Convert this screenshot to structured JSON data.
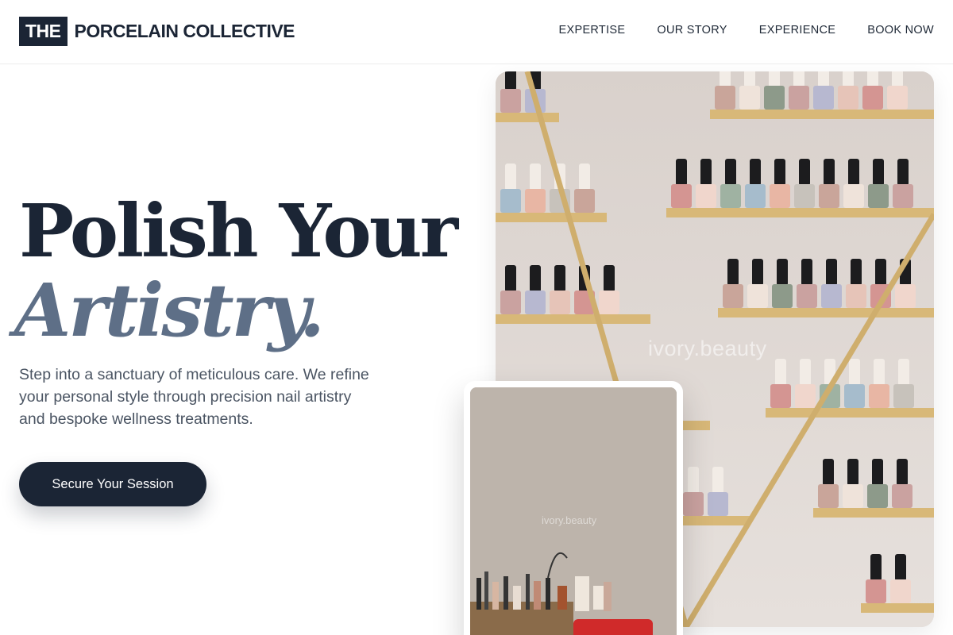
{
  "brand": {
    "box": "THE",
    "name": "PORCELAIN COLLECTIVE"
  },
  "nav": [
    "EXPERTISE",
    "OUR STORY",
    "EXPERIENCE",
    "BOOK NOW"
  ],
  "hero": {
    "line1": "Polish Your",
    "line2": "Artistry.",
    "intro": "Step into a sanctuary of meticulous care. We refine your personal style through precision nail artistry and bespoke wellness treatments.",
    "cta": "Secure Your Session"
  },
  "images": {
    "main_watermark": "ivory.beauty",
    "secondary_watermark": "ivory.beauty",
    "main_icon": "nail-polish-shelf-photo",
    "secondary_icon": "vanity-tools-photo"
  },
  "colors": {
    "brand_navy": "#1b2535",
    "accent_slate": "#5e6f87",
    "gold": "#d8b878"
  }
}
